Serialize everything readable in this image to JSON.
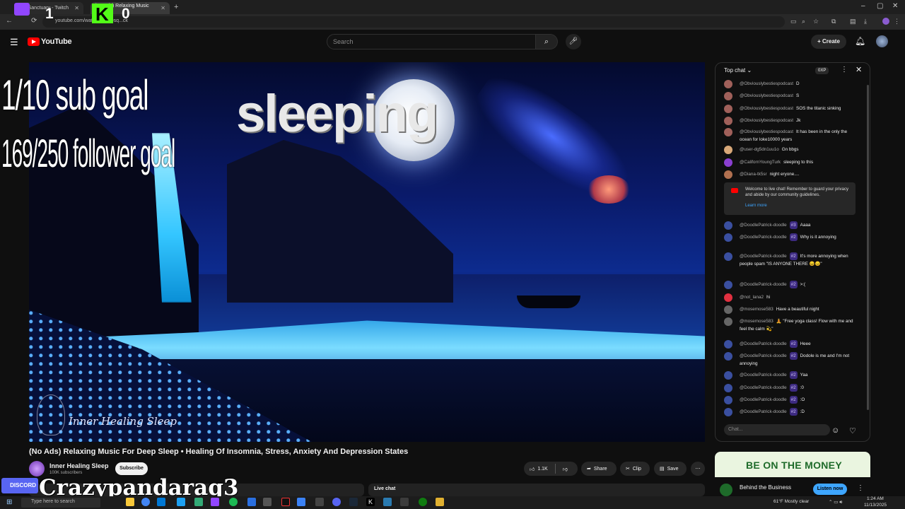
{
  "browser": {
    "tabs": [
      {
        "label": "yourSanctuary - Twitch"
      },
      {
        "label": "(No Ads) Relaxing Music For..."
      }
    ],
    "new_tab": "+",
    "url": "youtube.com/watch?v=...Dsq...ck",
    "window_controls": [
      "–",
      "▢",
      "✕"
    ]
  },
  "youtube": {
    "logo_text": "YouTube",
    "search_placeholder": "Search",
    "create_label": "+ Create"
  },
  "video": {
    "overlay_title": "sleeping",
    "channel_watermark": "Inner Healing Sleep"
  },
  "stream_overlay": {
    "sub_goal": "1/10 sub goal",
    "follower_goal": "169/250 follower goal",
    "twitch_count": "1",
    "kick_count": "0",
    "discord_label": "DISCORD",
    "streamer_name": "Crazypandarag3"
  },
  "info": {
    "title": "(No Ads) Relaxing Music For Deep Sleep • Healing Of Insomnia, Stress, Anxiety And Depression States",
    "channel": "Inner Healing Sleep",
    "subscribers": "100K subscribers",
    "subscribe_label": "Subscribe",
    "like_count": "1.1K",
    "share_label": "Share",
    "clip_label": "Clip",
    "save_label": "Save"
  },
  "chat": {
    "mode": "Top chat",
    "xp": "0XP",
    "input_placeholder": "Chat...",
    "welcome": "Welcome to live chat! Remember to guard your privacy and abide by our community guidelines.",
    "learn_more": "Learn more",
    "messages": [
      {
        "author": "@Obviouslybestiespodcast",
        "text": "D",
        "badge": "",
        "color": "#a0605a"
      },
      {
        "author": "@Obviouslybestiespodcast",
        "text": "S",
        "badge": "",
        "color": "#a0605a"
      },
      {
        "author": "@Obviouslybestiespodcast",
        "text": "SOS the titanic sinking",
        "badge": "",
        "color": "#a0605a"
      },
      {
        "author": "@Obviouslybestiespodcast",
        "text": "Jk",
        "badge": "",
        "color": "#a0605a"
      },
      {
        "author": "@Obviouslybestiespodcast",
        "text": "It has been in the only the ocean for loke10000 years",
        "badge": "",
        "color": "#a0605a"
      },
      {
        "author": "@user-dg5dn1uu1o",
        "text": "Gn bbgs",
        "badge": "",
        "color": "#d8a878"
      },
      {
        "author": "@CalifornYoungTurk",
        "text": "sleeping to this",
        "badge": "",
        "color": "#8a3fd0"
      },
      {
        "author": "@Diana-tk5sr",
        "text": "night eryone....",
        "badge": "",
        "color": "#b07050"
      },
      {
        "author": "@DoodlePatrick-doodle",
        "text": "Aaaa",
        "badge": "#3",
        "color": "#3a4fa0"
      },
      {
        "author": "@DoodlePatrick-doodle",
        "text": "Why is it annoying",
        "badge": "#2",
        "color": "#3a4fa0"
      },
      {
        "author": "@DoodlePatrick-doodle",
        "text": "It's more annoying when people spam \"IS ANYONE THERE 😖😠\"",
        "badge": "#2",
        "color": "#3a4fa0"
      },
      {
        "author": "@DoodlePatrick-doodle",
        "text": ">:(",
        "badge": "#2",
        "color": "#3a4fa0"
      },
      {
        "author": "@not_lana2",
        "text": "hi",
        "badge": "",
        "color": "#e03040"
      },
      {
        "author": "@mosemose583",
        "text": "Have a beautiful night",
        "badge": "",
        "color": "#666"
      },
      {
        "author": "@mosemose583",
        "text": "🧘 \"Free yoga class! Flow with me and feel the calm 💫\"",
        "badge": "",
        "color": "#666"
      },
      {
        "author": "@DoodlePatrick-doodle",
        "text": "Heee",
        "badge": "#2",
        "color": "#3a4fa0"
      },
      {
        "author": "@DoodlePatrick-doodle",
        "text": "Dodole is me and I'm not annoying",
        "badge": "#2",
        "color": "#3a4fa0"
      },
      {
        "author": "@DoodlePatrick-doodle",
        "text": "Yaa",
        "badge": "#2",
        "color": "#3a4fa0"
      },
      {
        "author": "@DoodlePatrick-doodle",
        "text": ":0",
        "badge": "#2",
        "color": "#3a4fa0"
      },
      {
        "author": "@DoodlePatrick-doodle",
        "text": ":O",
        "badge": "#2",
        "color": "#3a4fa0"
      },
      {
        "author": "@DoodlePatrick-doodle",
        "text": ":D",
        "badge": "#2",
        "color": "#3a4fa0"
      }
    ]
  },
  "below": {
    "live_chat_label": "Live chat",
    "ad_headline": "BE ON THE MONEY",
    "ad_title": "Behind the Business",
    "ad_button": "Listen now"
  },
  "taskbar": {
    "search_placeholder": "Type here to search",
    "weather": "61°F  Mostly clear",
    "time": "1:24 AM",
    "date": "11/13/2025"
  }
}
